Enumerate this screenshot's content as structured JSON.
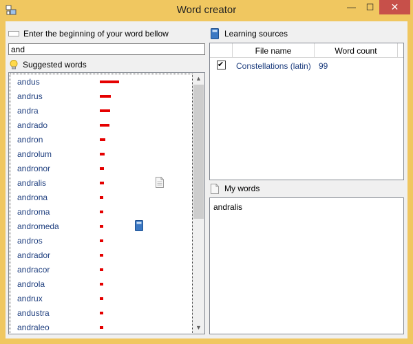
{
  "window": {
    "title": "Word creator",
    "min_glyph": "—",
    "max_glyph": "☐",
    "close_glyph": "✕"
  },
  "icons": {
    "app": "app-icon",
    "textbox": "textbox-icon",
    "bulb": "lightbulb-icon",
    "book": "book-icon",
    "page": "document-icon"
  },
  "search": {
    "label": "Enter the beginning of your word bellow",
    "value": "and"
  },
  "suggested": {
    "label": "Suggested words",
    "items": [
      {
        "word": "andus",
        "strength": 0.7,
        "marker": ""
      },
      {
        "word": "andrus",
        "strength": 0.4,
        "marker": ""
      },
      {
        "word": "andra",
        "strength": 0.38,
        "marker": ""
      },
      {
        "word": "andrado",
        "strength": 0.35,
        "marker": ""
      },
      {
        "word": "andron",
        "strength": 0.2,
        "marker": ""
      },
      {
        "word": "androlum",
        "strength": 0.18,
        "marker": ""
      },
      {
        "word": "andronor",
        "strength": 0.16,
        "marker": ""
      },
      {
        "word": "andralis",
        "strength": 0.14,
        "marker": "document-icon"
      },
      {
        "word": "androna",
        "strength": 0.13,
        "marker": ""
      },
      {
        "word": "androma",
        "strength": 0.12,
        "marker": ""
      },
      {
        "word": "andromeda",
        "strength": 0.12,
        "marker": "book-icon"
      },
      {
        "word": "andros",
        "strength": 0.11,
        "marker": ""
      },
      {
        "word": "andrador",
        "strength": 0.1,
        "marker": ""
      },
      {
        "word": "andracor",
        "strength": 0.09,
        "marker": ""
      },
      {
        "word": "androla",
        "strength": 0.08,
        "marker": ""
      },
      {
        "word": "andrux",
        "strength": 0.08,
        "marker": ""
      },
      {
        "word": "andustra",
        "strength": 0.07,
        "marker": ""
      },
      {
        "word": "andraleo",
        "strength": 0.07,
        "marker": ""
      }
    ]
  },
  "sources": {
    "label": "Learning sources",
    "columns": [
      "File name",
      "Word count"
    ],
    "rows": [
      {
        "checked": true,
        "check_glyph": "✔",
        "file": "Constellations (latin)",
        "count": "99"
      }
    ]
  },
  "mywords": {
    "label": "My words",
    "text": "andralis"
  },
  "colors": {
    "accent": "#f0c760",
    "bar": "#e50000",
    "link_text": "#1f3f7f",
    "close": "#c7504a"
  }
}
